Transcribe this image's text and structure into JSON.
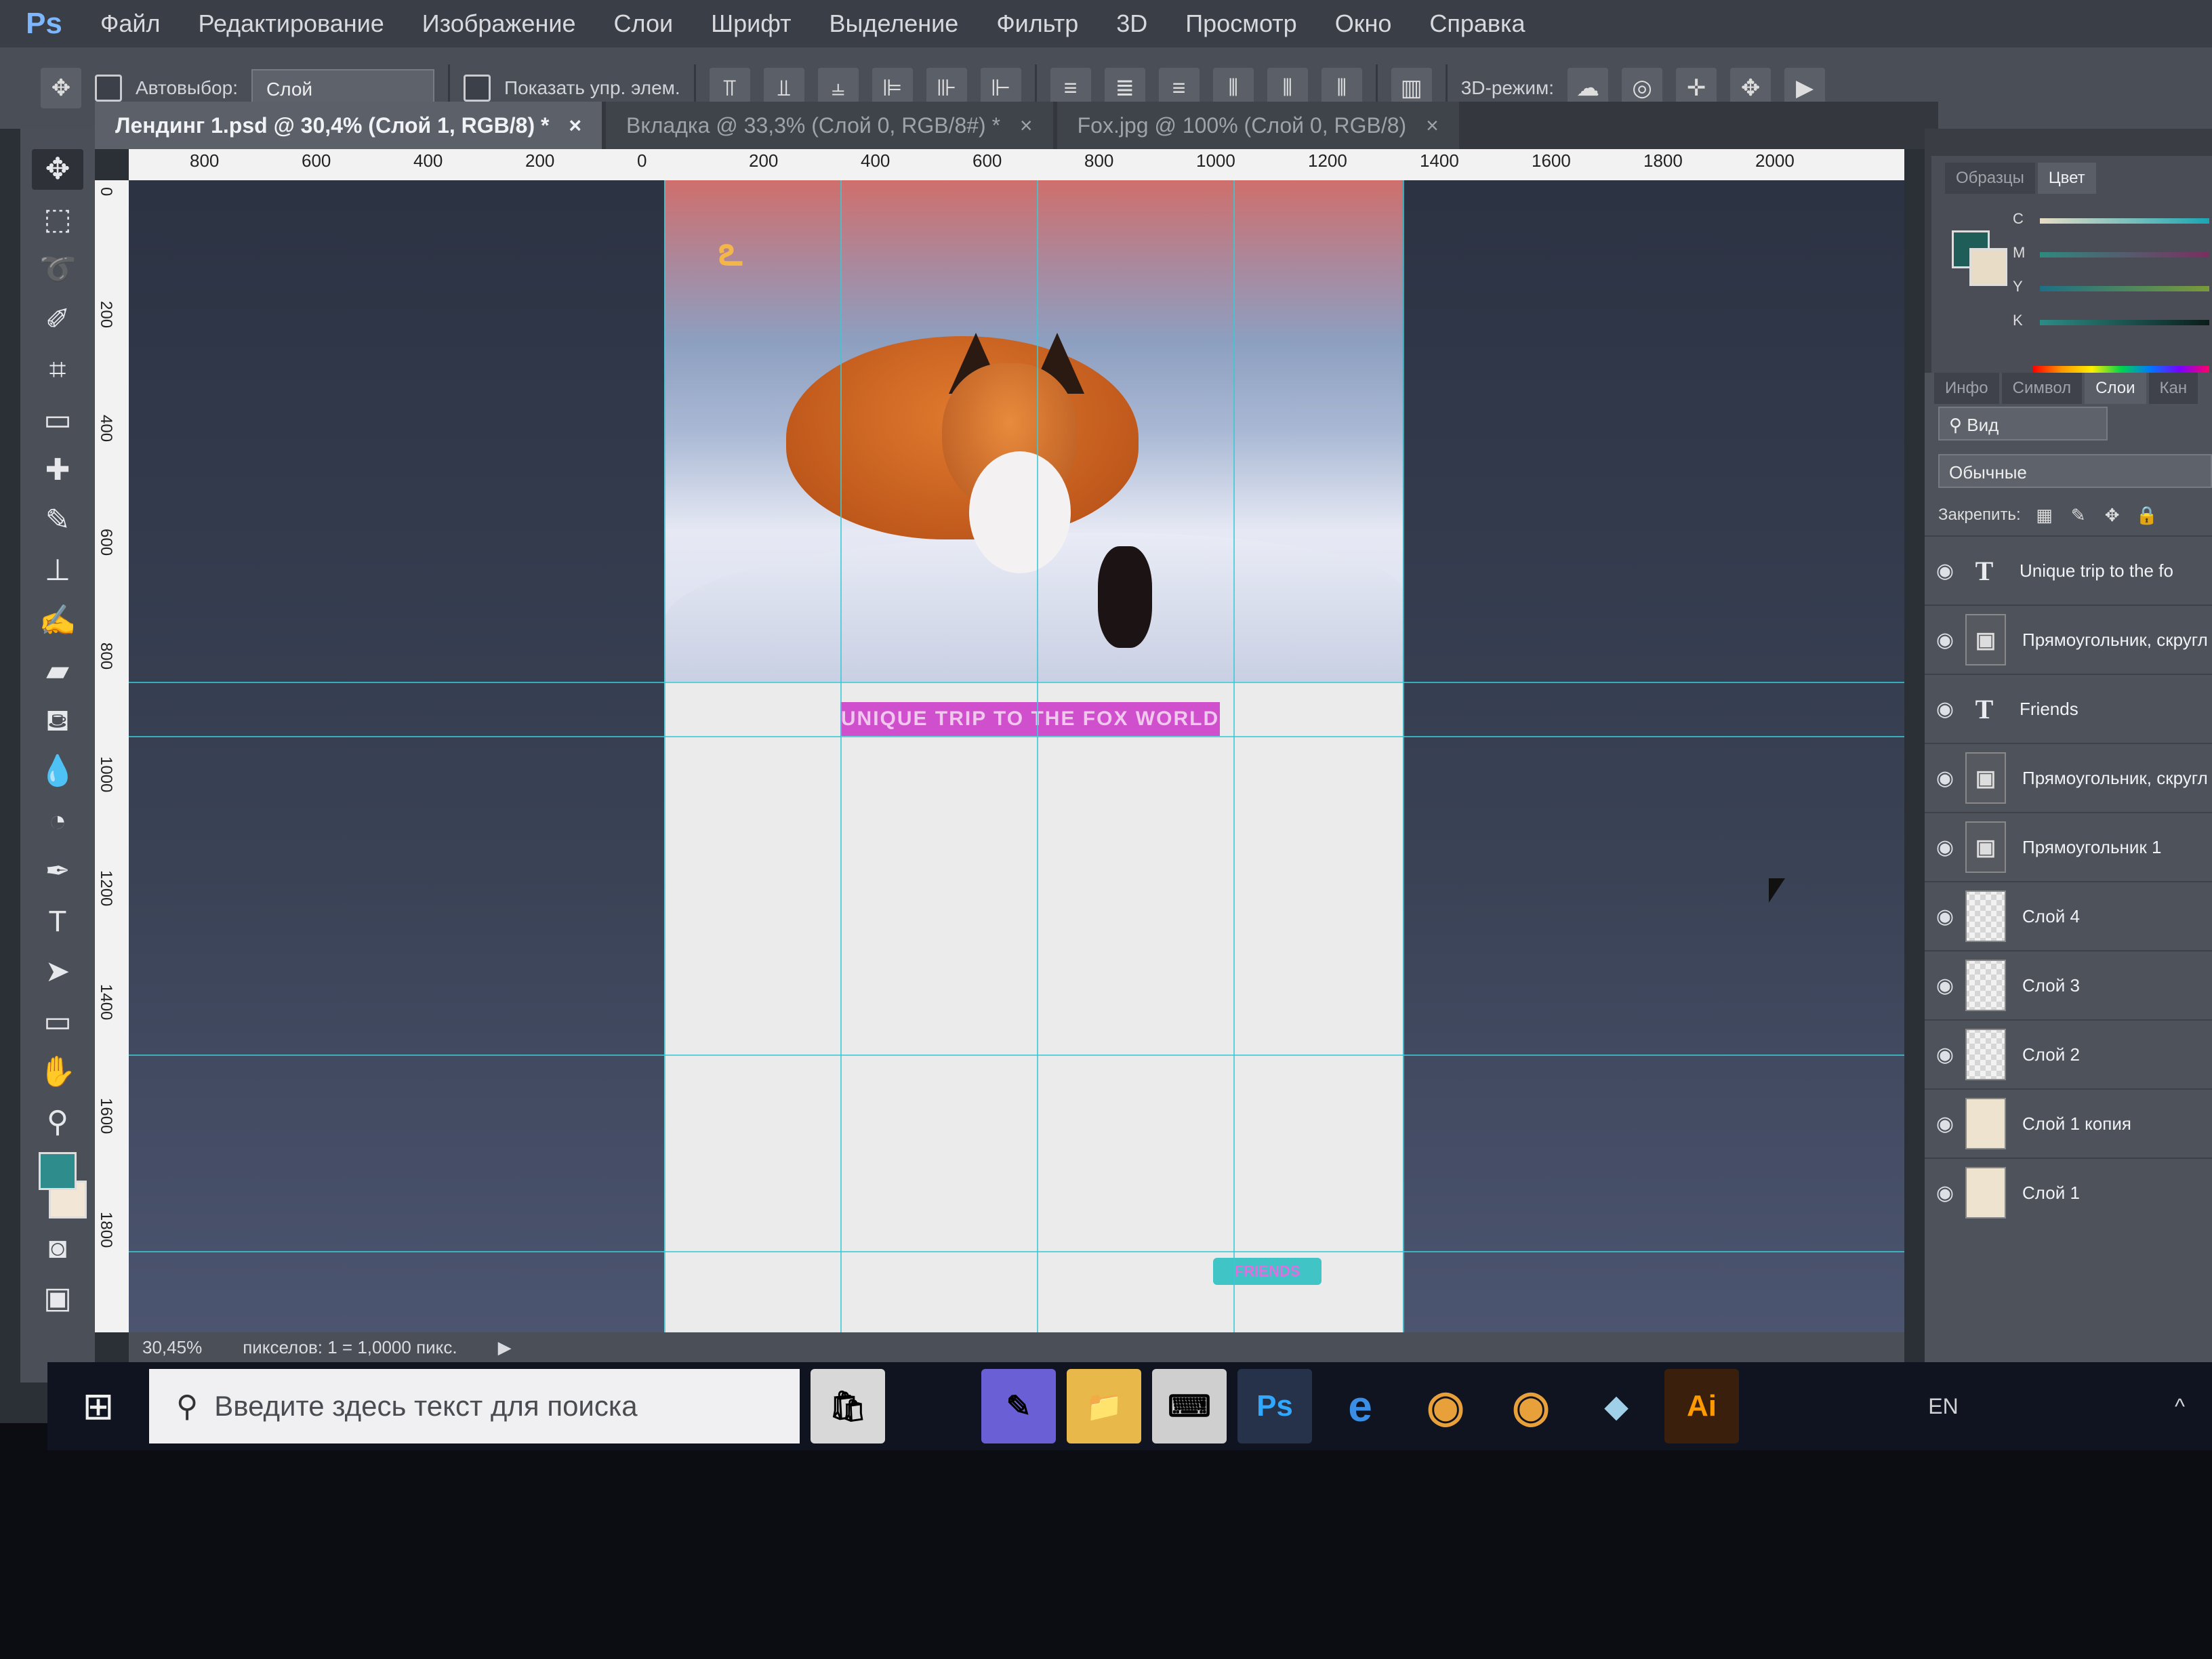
{
  "menubar": {
    "app_logo": "Ps",
    "items": [
      "Файл",
      "Редактирование",
      "Изображение",
      "Слои",
      "Шрифт",
      "Выделение",
      "Фильтр",
      "3D",
      "Просмотр",
      "Окно",
      "Справка"
    ]
  },
  "options": {
    "autoselect_label": "Автовыбор:",
    "autoselect_value": "Слой",
    "show_transform_label": "Показать упр. элем.",
    "mode_3d_label": "3D-режим:"
  },
  "tabs": [
    {
      "label": "Лендинг 1.psd @ 30,4% (Слой 1, RGB/8) *",
      "close": "×"
    },
    {
      "label": "Вкладка @ 33,3% (Слой 0, RGB/8#) *",
      "close": "×"
    },
    {
      "label": "Fox.jpg @ 100% (Слой 0, RGB/8)",
      "close": "×"
    }
  ],
  "ruler_top": [
    "800",
    "600",
    "400",
    "200",
    "0",
    "200",
    "400",
    "600",
    "800",
    "1000",
    "1200",
    "1400",
    "1600",
    "1800",
    "2000"
  ],
  "ruler_left": [
    "0",
    "200",
    "400",
    "600",
    "800",
    "1000",
    "1200",
    "1400",
    "1600",
    "1800"
  ],
  "canvas": {
    "headline": "UNIQUE TRIP TO THE FOX WORLD",
    "button": "FRIENDS"
  },
  "status": {
    "zoom": "30,45%",
    "info": "пикселов: 1 = 1,0000 пикс."
  },
  "color_panel": {
    "tabs": [
      "Образцы",
      "Цвет"
    ],
    "channels": [
      "C",
      "M",
      "Y",
      "K"
    ],
    "channel_levels": [
      0.05,
      0.1,
      0.55,
      0.0
    ],
    "fg_color": "#1f5e58",
    "bg_color": "#e8dcc6"
  },
  "layers_panel": {
    "tabs": [
      "Инфо",
      "Символ",
      "Слои",
      "Кан"
    ],
    "search_kind": "Вид",
    "blend_mode": "Обычные",
    "lock_label": "Закрепить:",
    "layers": [
      {
        "name": "Unique trip to the fo",
        "thumb": "T",
        "kind": "type"
      },
      {
        "name": "Прямоугольник, скругл",
        "thumb": "▣",
        "kind": "shape"
      },
      {
        "name": "Friends",
        "thumb": "T",
        "kind": "type"
      },
      {
        "name": "Прямоугольник, скругл",
        "thumb": "▣",
        "kind": "shape"
      },
      {
        "name": "Прямоугольник 1",
        "thumb": "▣",
        "kind": "shape"
      },
      {
        "name": "Слой 4",
        "thumb": "",
        "kind": "checker"
      },
      {
        "name": "Слой 3",
        "thumb": "",
        "kind": "checker"
      },
      {
        "name": "Слой 2",
        "thumb": "",
        "kind": "checker"
      },
      {
        "name": "Слой 1 копия",
        "thumb": "",
        "kind": "fill"
      },
      {
        "name": "Слой 1",
        "thumb": "",
        "kind": "fill"
      }
    ]
  },
  "taskbar": {
    "search_placeholder": "Введите здесь текст для поиска",
    "apps": [
      {
        "label": "🛍",
        "color": "#d8d8d8"
      },
      {
        "label": "",
        "color": "#0f1420"
      },
      {
        "label": "✎",
        "color": "#6b5fd6"
      },
      {
        "label": "📁",
        "color": "#e8b84a"
      },
      {
        "label": "⌨",
        "color": "#cfcfcf"
      },
      {
        "label": "Ps",
        "color": "#26324a"
      },
      {
        "label": "e",
        "color": "#0f1420"
      },
      {
        "label": "◉",
        "color": "#0f1420"
      },
      {
        "label": "◉",
        "color": "#0f1420"
      },
      {
        "label": "◆",
        "color": "#0f1420"
      },
      {
        "label": "Ai",
        "color": "#3a1f0d"
      }
    ],
    "language": "EN",
    "tray_icon": "^"
  }
}
